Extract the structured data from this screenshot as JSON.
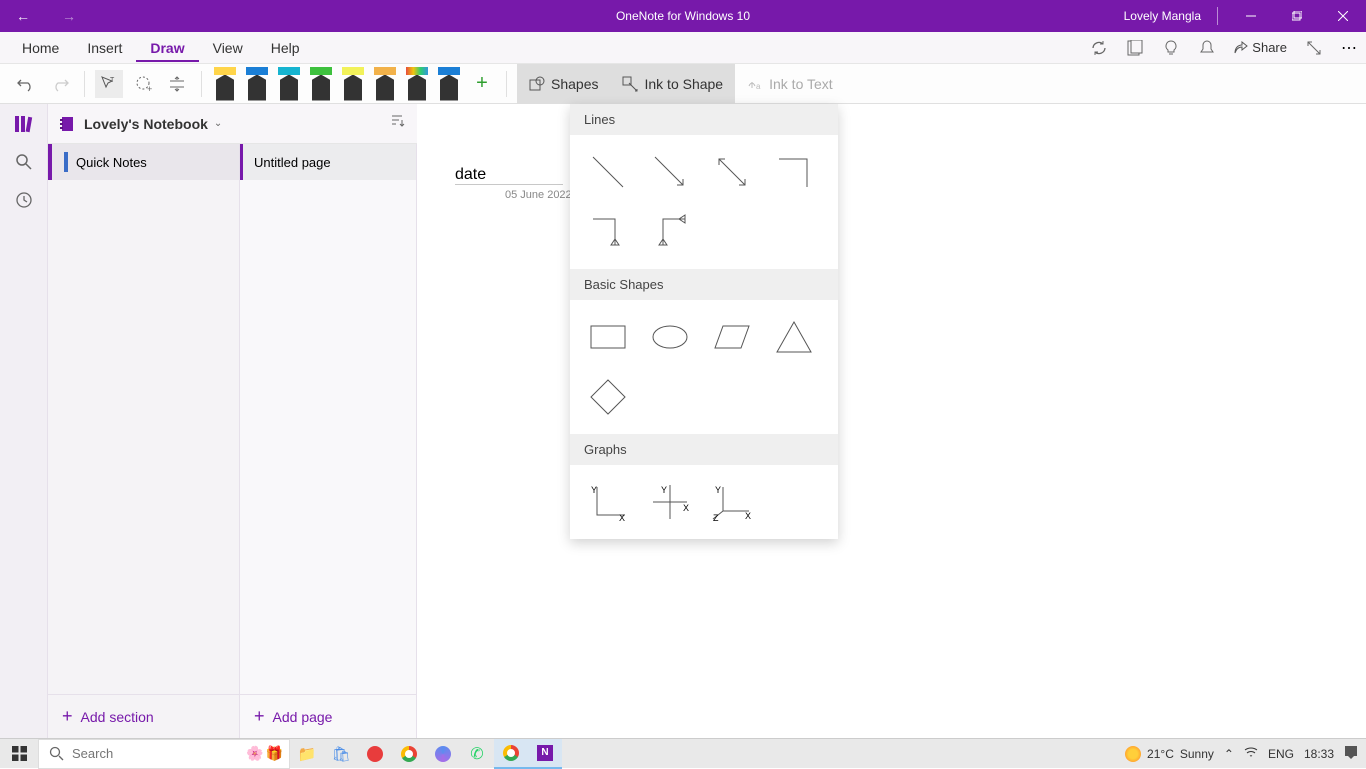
{
  "titlebar": {
    "title": "OneNote for Windows 10",
    "user": "Lovely Mangla"
  },
  "menu": {
    "home": "Home",
    "insert": "Insert",
    "draw": "Draw",
    "view": "View",
    "help": "Help",
    "share": "Share"
  },
  "ribbon": {
    "pens": [
      {
        "cap": "#FFD54A",
        "tip": "#2b2b2b"
      },
      {
        "cap": "#1b7fd6",
        "tip": "#2b2b2b"
      },
      {
        "cap": "#16b4d0",
        "tip": "#2b2b2b"
      },
      {
        "cap": "#3ec13e",
        "tip": "#2b2b2b"
      },
      {
        "cap": "#f2f25a",
        "tip": "#2b2b2b"
      },
      {
        "cap": "#f2b24a",
        "tip": "#2b2b2b"
      },
      {
        "cap": "linear-gradient(90deg,#e74c3c,#f1c40f,#2ecc71,#3498db)",
        "tip": "#2b2b2b"
      },
      {
        "cap": "#1b7fd6",
        "tip": "#2b2b2b"
      }
    ],
    "shapes": "Shapes",
    "ink_to_shape": "Ink to Shape",
    "ink_to_text": "Ink to Text"
  },
  "notebook": {
    "name": "Lovely's Notebook"
  },
  "sections": [
    {
      "name": "Quick Notes"
    }
  ],
  "pages": [
    {
      "name": "Untitled page"
    }
  ],
  "add_section": "Add section",
  "add_page": "Add page",
  "canvas": {
    "date": "05 June 2022"
  },
  "shapes_dd": {
    "lines": "Lines",
    "basic": "Basic Shapes",
    "graphs": "Graphs"
  },
  "taskbar": {
    "search_placeholder": "Search",
    "weather_temp": "21°C",
    "weather_cond": "Sunny",
    "lang": "ENG",
    "time": "18:33"
  }
}
